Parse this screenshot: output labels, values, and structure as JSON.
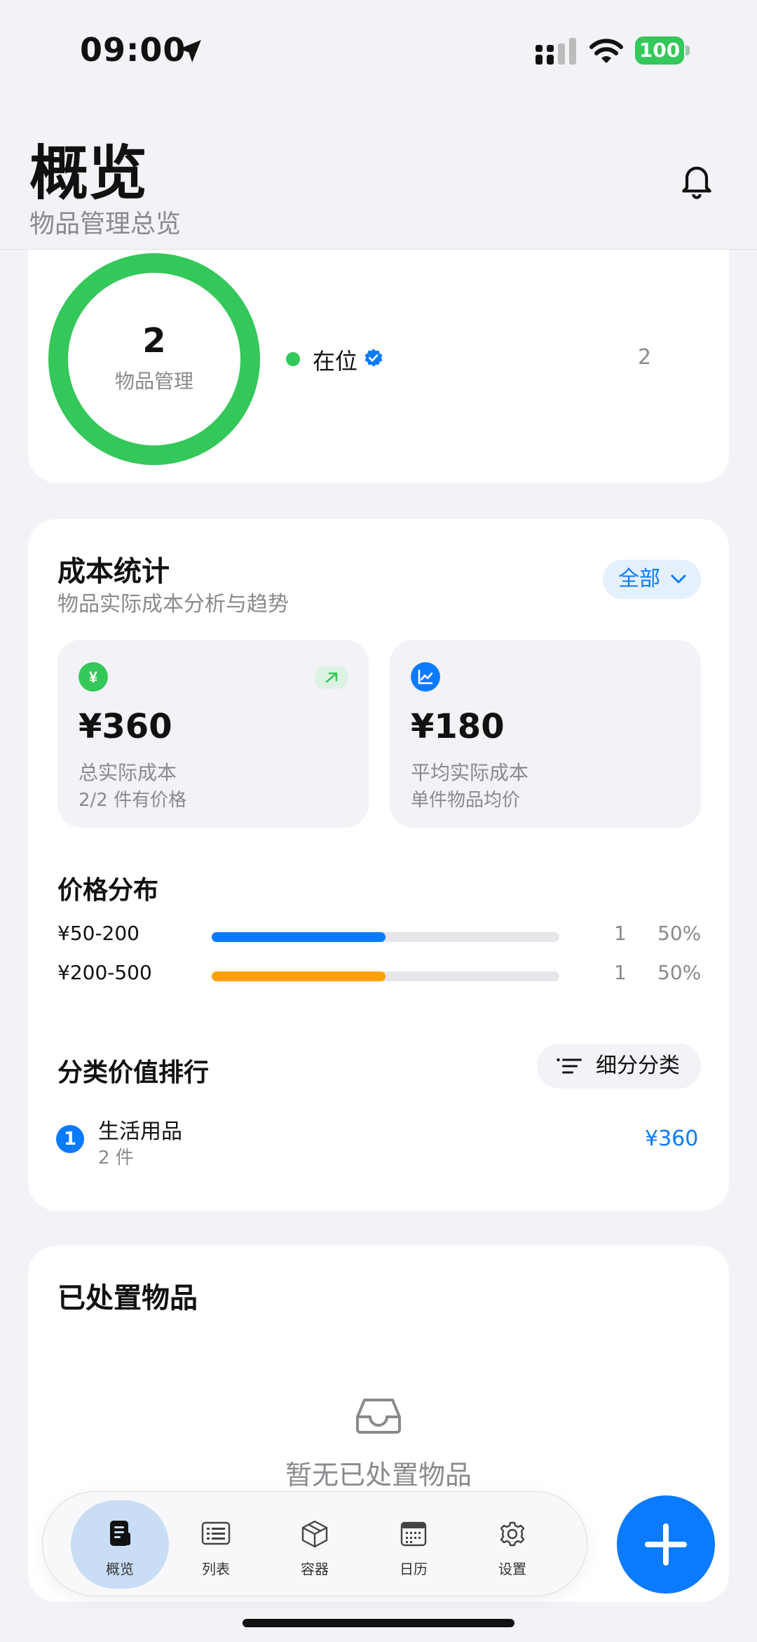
{
  "status_bar": {
    "time": "09:00",
    "battery": "100"
  },
  "header": {
    "title": "概览",
    "subtitle": "物品管理总览"
  },
  "overview": {
    "total": "2",
    "total_label": "物品管理",
    "legend": [
      {
        "label": "在位",
        "count": "2",
        "color": "#34c759"
      }
    ]
  },
  "cost": {
    "title": "成本统计",
    "subtitle": "物品实际成本分析与趋势",
    "filter_label": "全部",
    "stats": [
      {
        "value": "¥360",
        "label": "总实际成本",
        "note": "2/2 件有价格"
      },
      {
        "value": "¥180",
        "label": "平均实际成本",
        "note": "单件物品均价"
      }
    ],
    "price_dist_title": "价格分布",
    "ranges": [
      {
        "label": "¥50-200",
        "count": "1",
        "percent": "50%",
        "fraction": 0.5,
        "color": "#0a7aff"
      },
      {
        "label": "¥200-500",
        "count": "1",
        "percent": "50%",
        "fraction": 0.5,
        "color": "#ff9f0a"
      }
    ],
    "category_title": "分类价值排行",
    "subdivide_label": "细分分类",
    "ranking": [
      {
        "rank": "1",
        "name": "生活用品",
        "count": "2 件",
        "value": "¥360"
      }
    ]
  },
  "disposed": {
    "title": "已处置物品",
    "empty_text": "暂无已处置物品"
  },
  "tabs": [
    {
      "label": "概览"
    },
    {
      "label": "列表"
    },
    {
      "label": "容器"
    },
    {
      "label": "日历"
    },
    {
      "label": "设置"
    }
  ]
}
